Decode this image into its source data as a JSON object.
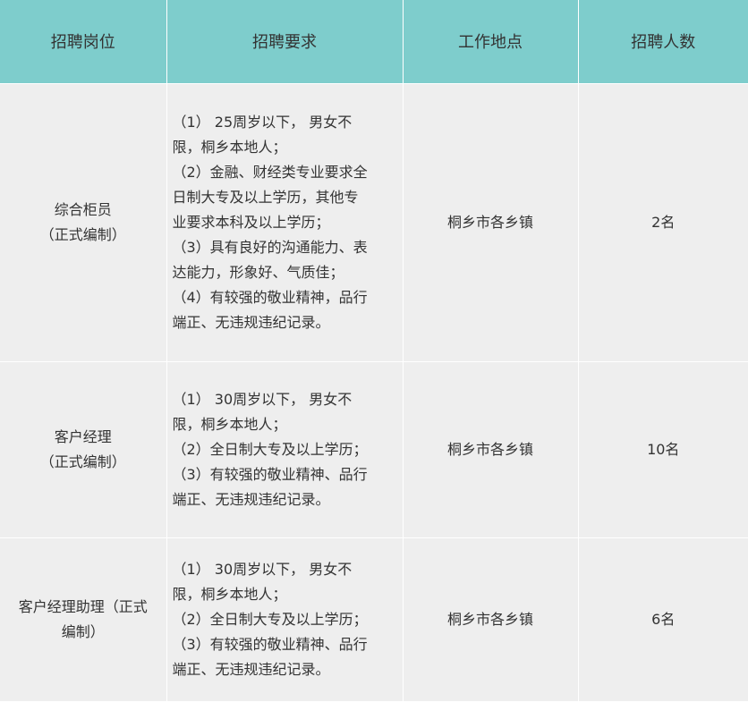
{
  "table": {
    "headers": [
      "招聘岗位",
      "招聘要求",
      "工作地点",
      "招聘人数"
    ],
    "rows": [
      {
        "position": [
          "综合柜员",
          "（正式编制）"
        ],
        "requirements": [
          "（1） 25周岁以下， 男女不",
          "限，桐乡本地人；",
          "（2）金融、财经类专业要求全",
          "日制大专及以上学历，其他专",
          "业要求本科及以上学历；",
          "（3）具有良好的沟通能力、表",
          "达能力，形象好、气质佳；",
          "（4）有较强的敬业精神，品行",
          "端正、无违规违纪记录。"
        ],
        "location": "桐乡市各乡镇",
        "count": "2名"
      },
      {
        "position": [
          "客户经理",
          "（正式编制）"
        ],
        "requirements": [
          "（1） 30周岁以下， 男女不",
          "限，桐乡本地人；",
          "（2）全日制大专及以上学历；",
          "（3）有较强的敬业精神、品行",
          "端正、无违规违纪记录。"
        ],
        "location": "桐乡市各乡镇",
        "count": "10名"
      },
      {
        "position": [
          "客户经理助理（正式",
          "编制）"
        ],
        "requirements": [
          "（1） 30周岁以下， 男女不",
          "限，桐乡本地人；",
          "（2）全日制大专及以上学历；",
          "（3）有较强的敬业精神、品行",
          "端正、无违规违纪记录。"
        ],
        "location": "桐乡市各乡镇",
        "count": "6名"
      }
    ]
  },
  "colors": {
    "header_bg": "#7ecdcc",
    "row_bg": "#eeeeee",
    "text": "#333333"
  }
}
